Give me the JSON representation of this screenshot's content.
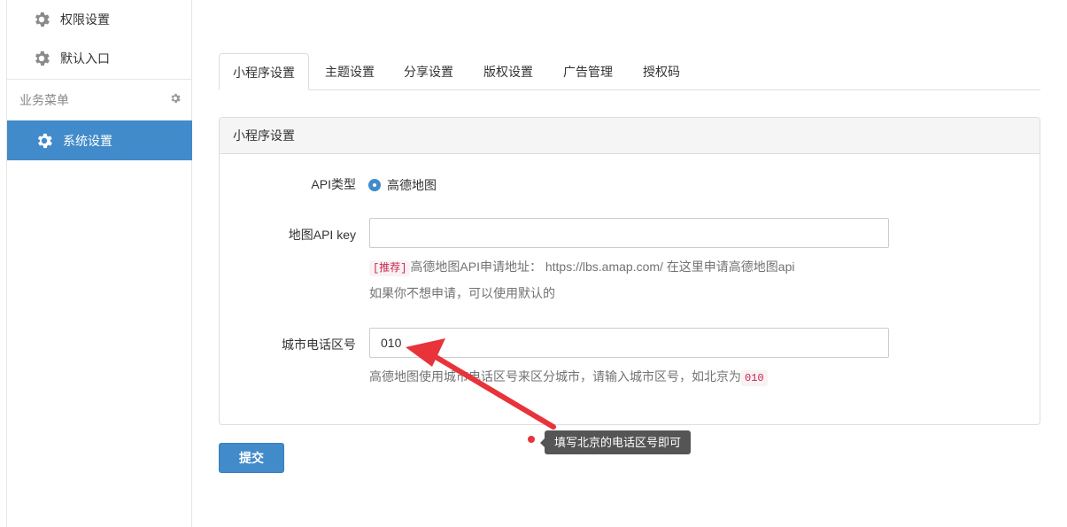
{
  "sidebar": {
    "items": [
      {
        "label": "权限设置",
        "icon": "gear-icon"
      },
      {
        "label": "默认入口",
        "icon": "gear-icon"
      }
    ],
    "section_title": "业务菜单",
    "active_item": {
      "label": "系统设置",
      "icon": "gear-icon"
    }
  },
  "tabs": [
    {
      "label": "小程序设置",
      "active": true
    },
    {
      "label": "主题设置"
    },
    {
      "label": "分享设置"
    },
    {
      "label": "版权设置"
    },
    {
      "label": "广告管理"
    },
    {
      "label": "授权码"
    }
  ],
  "panel": {
    "title": "小程序设置",
    "api_type": {
      "label": "API类型",
      "option": "高德地图",
      "selected": true
    },
    "api_key": {
      "label": "地图API key",
      "value": "",
      "help_tag": "[推荐]",
      "help_text": "高德地图API申请地址： https://lbs.amap.com/ 在这里申请高德地图api",
      "help_text_2": "如果你不想申请，可以使用默认的"
    },
    "city_code": {
      "label": "城市电话区号",
      "value": "010",
      "help_text": "高德地图使用城市电话区号来区分城市，请输入城市区号，如北京为",
      "help_code": "010"
    }
  },
  "submit_label": "提交",
  "annotation": {
    "text": "填写北京的电话区号即可",
    "color": "#e8333b"
  },
  "colors": {
    "primary": "#428bca",
    "danger": "#c7254e"
  }
}
